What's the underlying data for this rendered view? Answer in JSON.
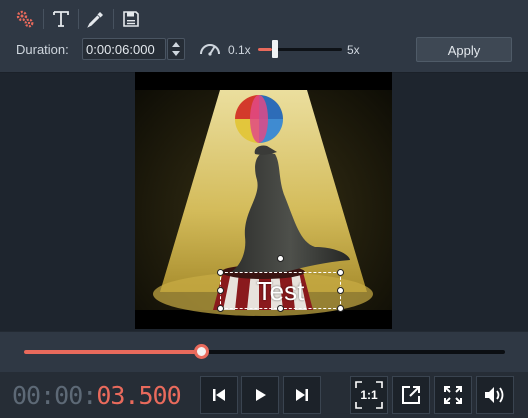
{
  "toolbar": {
    "tools": [
      {
        "name": "effects-tool",
        "icon": "gears-icon"
      },
      {
        "name": "text-tool",
        "icon": "text-T-icon"
      },
      {
        "name": "color-picker-tool",
        "icon": "eyedropper-icon"
      },
      {
        "name": "save-frame-tool",
        "icon": "floppy-disk-icon"
      }
    ],
    "duration_label": "Duration:",
    "duration_value": "0:00:06:000",
    "speed_icon": "speedometer-icon",
    "speed_min": "0.1x",
    "speed_max": "5x",
    "speed_level": 0.17,
    "apply_label": "Apply"
  },
  "preview": {
    "title_text": "Test"
  },
  "timeline": {
    "progress": 0.36
  },
  "playback": {
    "timecode_elapsed": "00:00:",
    "timecode_current": "03.500",
    "buttons": [
      "previous-frame-icon",
      "play-icon",
      "next-frame-icon"
    ],
    "ratio_label": "1:1",
    "extra_buttons": [
      "popout-icon",
      "fullscreen-icon",
      "volume-icon"
    ]
  },
  "colors": {
    "accent": "#e96a5c",
    "toolbar_bg": "#2f3844",
    "panel_bg": "#1e252e"
  }
}
